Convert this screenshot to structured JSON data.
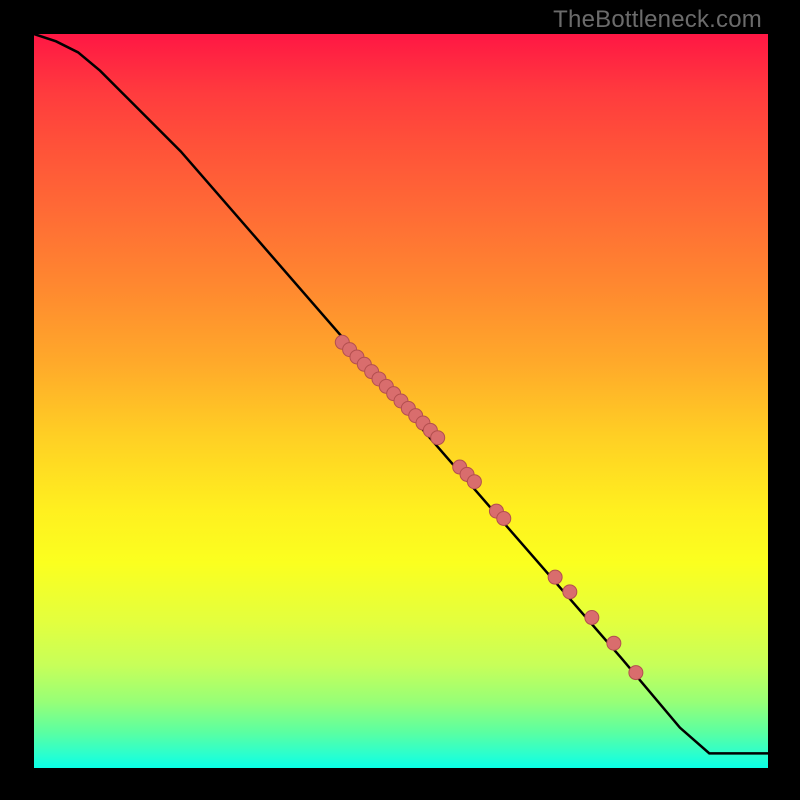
{
  "watermark": "TheBottleneck.com",
  "chart_data": {
    "type": "line",
    "title": "",
    "xlabel": "",
    "ylabel": "",
    "xlim": [
      0,
      100
    ],
    "ylim": [
      0,
      100
    ],
    "series": [
      {
        "name": "curve",
        "x": [
          0,
          3,
          6,
          9,
          12,
          15,
          20,
          30,
          40,
          50,
          60,
          70,
          80,
          88,
          92,
          100
        ],
        "y": [
          100,
          99,
          97.5,
          95,
          92,
          89,
          84,
          72.5,
          61,
          49.5,
          38,
          26.5,
          15,
          5.5,
          2,
          2
        ]
      }
    ],
    "scatter": {
      "name": "points",
      "color": "#e06666",
      "x": [
        42,
        43,
        44,
        45,
        46,
        47,
        48,
        49,
        50,
        51,
        52,
        53,
        54,
        55,
        58,
        59,
        60,
        63,
        64,
        71,
        73,
        76,
        79,
        82
      ],
      "y": [
        58,
        57,
        56,
        55,
        54,
        53,
        52,
        51,
        50,
        49,
        48,
        47,
        46,
        45,
        41,
        40,
        39,
        35,
        34,
        26,
        24,
        20.5,
        17,
        13
      ],
      "r": 7
    },
    "colors": {
      "line": "#000000",
      "scatter_fill": "#d96d6d",
      "scatter_stroke": "#b34f4f"
    }
  }
}
